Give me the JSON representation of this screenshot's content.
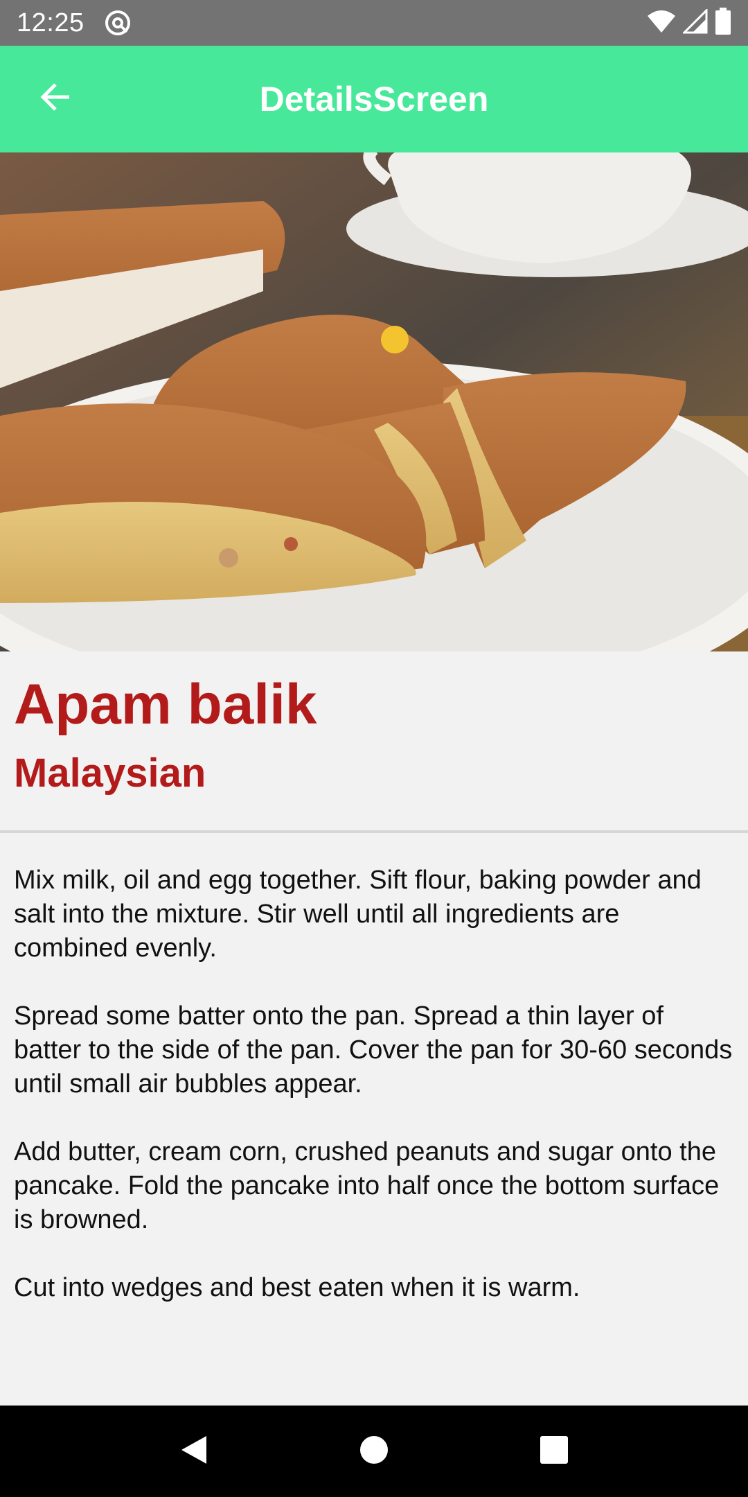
{
  "status_bar": {
    "time": "12:25",
    "icons": [
      "at-sign-icon",
      "wifi-icon",
      "signal-icon",
      "battery-icon"
    ]
  },
  "app_bar": {
    "title": "DetailsScreen",
    "back_icon": "arrow-back-icon",
    "color": "#48e89a"
  },
  "hero_image": {
    "subject": "apam-balik-photo"
  },
  "detail": {
    "name": "Apam balik",
    "origin": "Malaysian",
    "accent_color": "#b31b1b",
    "description": "Mix milk, oil and egg together. Sift flour, baking powder and salt into the mixture. Stir well until all ingredients are combined evenly.\n\nSpread some batter onto the pan. Spread a thin layer of batter to the side of the pan. Cover the pan for 30-60 seconds until small air bubbles appear.\n\nAdd butter, cream corn, crushed peanuts and sugar onto the pancake. Fold the pancake into half once the bottom surface is browned.\n\nCut into wedges and best eaten when it is warm."
  },
  "nav_bar": {
    "buttons": [
      "back-triangle-icon",
      "home-circle-icon",
      "recents-square-icon"
    ]
  }
}
